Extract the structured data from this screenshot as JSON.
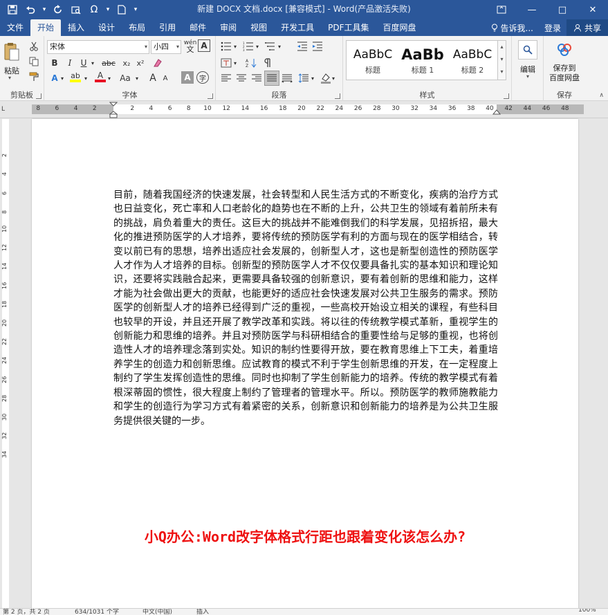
{
  "window": {
    "title": "新建 DOCX 文档.docx [兼容模式] - Word(产品激活失败)",
    "qat": {
      "save": "save-icon",
      "undo": "undo-icon",
      "redo": "redo-icon",
      "omega": "Ω"
    },
    "minimize": "—",
    "restore": "□",
    "close": "✕"
  },
  "tabs": [
    "文件",
    "开始",
    "插入",
    "设计",
    "布局",
    "引用",
    "邮件",
    "审阅",
    "视图",
    "开发工具",
    "PDF工具集",
    "百度网盘"
  ],
  "active_tab": "开始",
  "tell_me": "告诉我...",
  "login": "登录",
  "share": "共享",
  "ribbon": {
    "clipboard": {
      "label": "剪贴板",
      "paste": "粘贴"
    },
    "font": {
      "label": "字体",
      "name": "宋体",
      "size": "小四",
      "wen": "wén",
      "A_box": "A",
      "bold": "B",
      "italic": "I",
      "underline": "U",
      "strike": "abc",
      "sub": "x₂",
      "sup": "x²",
      "text_effect": "A",
      "highlight": "ab",
      "font_color": "A",
      "case": "Aa",
      "grow": "A",
      "shrink": "A",
      "shade_A": "A",
      "circle": "字"
    },
    "paragraph": {
      "label": "段落"
    },
    "styles": {
      "label": "样式",
      "items": [
        {
          "sample": "AaBbC",
          "name": "标题"
        },
        {
          "sample": "AaBb",
          "name": "标题 1"
        },
        {
          "sample": "AaBbC",
          "name": "标题 2"
        }
      ]
    },
    "editing": {
      "label": "编辑"
    },
    "save_group": {
      "label": "保存",
      "button": "保存到\n百度网盘",
      "line1": "保存到",
      "line2": "百度网盘"
    }
  },
  "ruler": {
    "corner": "L",
    "left_ticks": [
      "8",
      "6",
      "4",
      "2"
    ],
    "mid_ticks": [
      "2",
      "4",
      "6",
      "8",
      "10",
      "12",
      "14",
      "16",
      "18",
      "20",
      "22",
      "24",
      "26",
      "28",
      "30",
      "32",
      "34",
      "36",
      "38"
    ],
    "right_ticks": [
      "40",
      "42",
      "44",
      "46",
      "48"
    ],
    "v_ticks": [
      "2",
      "4",
      "6",
      "8",
      "10",
      "12",
      "14",
      "16",
      "18",
      "20",
      "22",
      "24",
      "26",
      "28",
      "30",
      "32",
      "34"
    ]
  },
  "document": {
    "body": "目前，随着我国经济的快速发展，社会转型和人民生活方式的不断变化，疾病的治疗方式也日益变化，死亡率和人口老龄化的趋势也在不断的上升，公共卫生的领域有着前所未有的挑战，肩负着重大的责任。这巨大的挑战并不能难倒我们的科学发展，见招拆招，最大化的推进预防医学的人才培养，要将传统的预防医学有利的方面与现在的医学相结合，转变以前已有的思想，培养出适应社会发展的，创新型人才，这也是新型创造性的预防医学人才作为人才培养的目标。创新型的预防医学人才不仅仅要具备扎实的基本知识和理论知识，还要将实践融合起来，更需要具备较强的创新意识，要有着创新的思维和能力，这样才能为社会做出更大的贡献，也能更好的适应社会快速发展对公共卫生服务的需求。预防医学的创新型人才的培养已经得到广泛的重视，一些高校开始设立相关的课程，有些科目也较早的开设，并且还开展了教学改革和实践。将以往的传统教学模式革新，重视学生的创新能力和思维的培养。并且对预防医学与科研相结合的重要性给与足够的重视，也将创造性人才的培养理念落到实处。知识的制约性要得开放，要在教育思维上下工夫，着重培养学生的创造力和创新思维。应试教育的模式不利于学生创新思维的开发，在一定程度上制约了学生发挥创造性的思维。同时也抑制了学生创新能力的培养。传统的教学模式有着根深蒂固的惯性，很大程度上制约了管理者的管理水平。所以。预防医学的教师施教能力和学生的创造行为学习方式有着紧密的关系，创新意识和创新能力的培养是为公共卫生服务提供很关键的一步。",
    "caption": "小Q办公:Word改字体格式行距也跟着变化该怎么办?"
  },
  "status": {
    "page": "第 2 页，共 2 页",
    "words": "634/1031 个字",
    "lang": "中文(中国)",
    "mode": "插入",
    "zoom": "100%"
  }
}
